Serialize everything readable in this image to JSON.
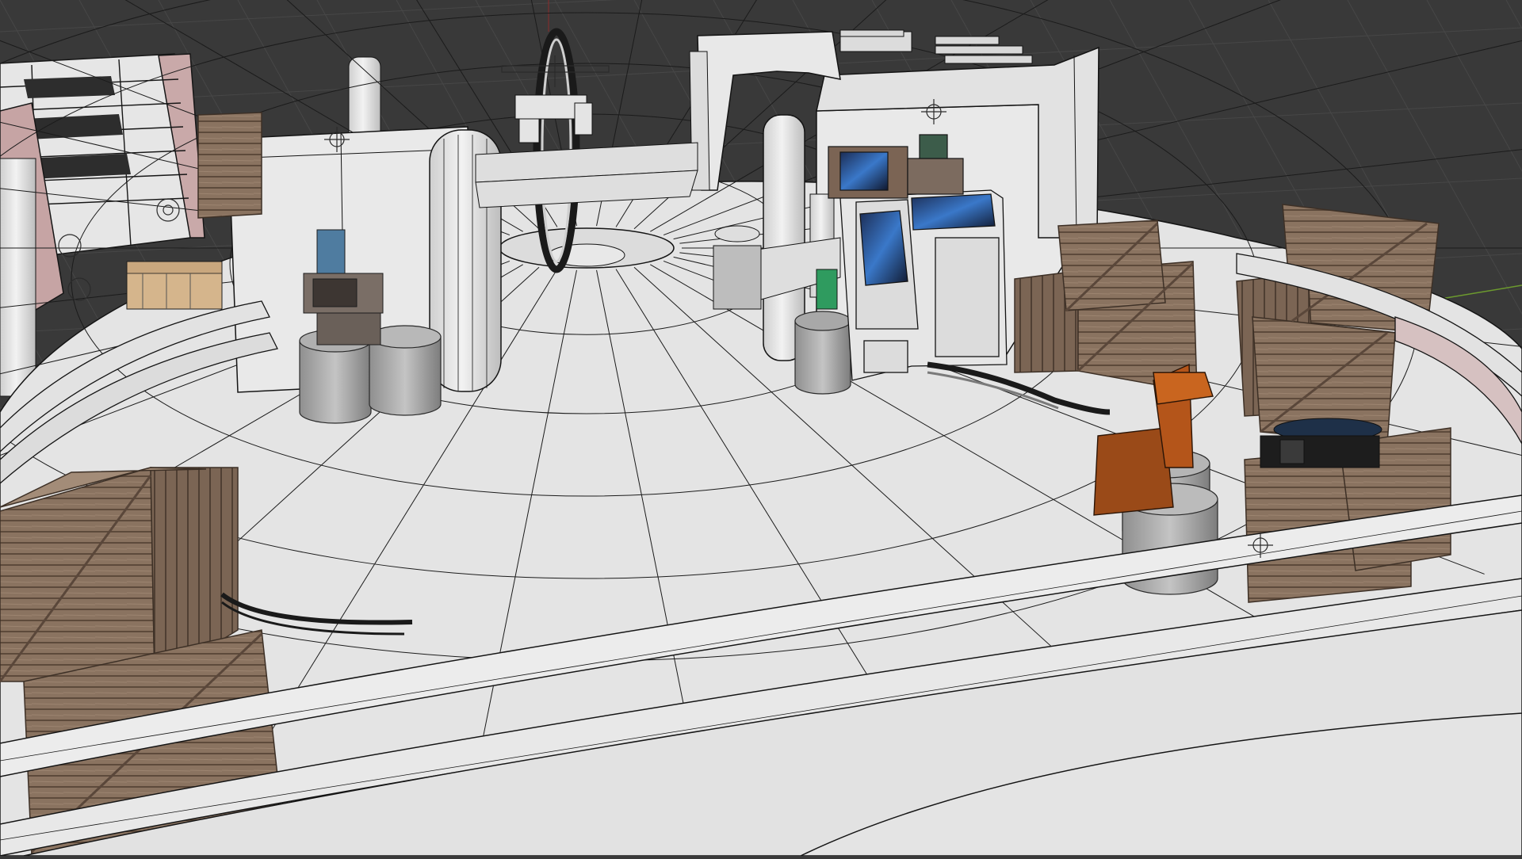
{
  "viewport": {
    "mode": "3d-viewport",
    "shading": "solid-with-wireframe-overlay",
    "visible_text": []
  },
  "colors": {
    "background": "#393939",
    "grid_line": "#474747",
    "x_axis": "#b3303c",
    "y_axis": "#6c9a2e",
    "mesh_face": "#e4e4e4",
    "mesh_wire": "#141414",
    "crate_wood": "#8a7360",
    "metal_floor": "#7d858a",
    "robot_arm": "#b4551a",
    "screen_glow": "#2f63b8",
    "origin_marker": "#2b2b2b"
  },
  "icons": [
    "object-origin-marker",
    "light-empty-icon",
    "camera-empty-icon"
  ],
  "scene_objects": [
    "circular-platform",
    "outer-railing",
    "inner-railing",
    "central-pillar",
    "pillar-left",
    "arched-gate",
    "ring-portal",
    "back-wall-left",
    "back-wall-right",
    "control-console",
    "crt-monitor",
    "small-monitor",
    "green-terminal",
    "wooden-crate-stack-right",
    "wooden-crate-stack-left",
    "orange-robot-arm",
    "metal-barrels",
    "cables",
    "metal-floor-plate",
    "background-staircase"
  ]
}
